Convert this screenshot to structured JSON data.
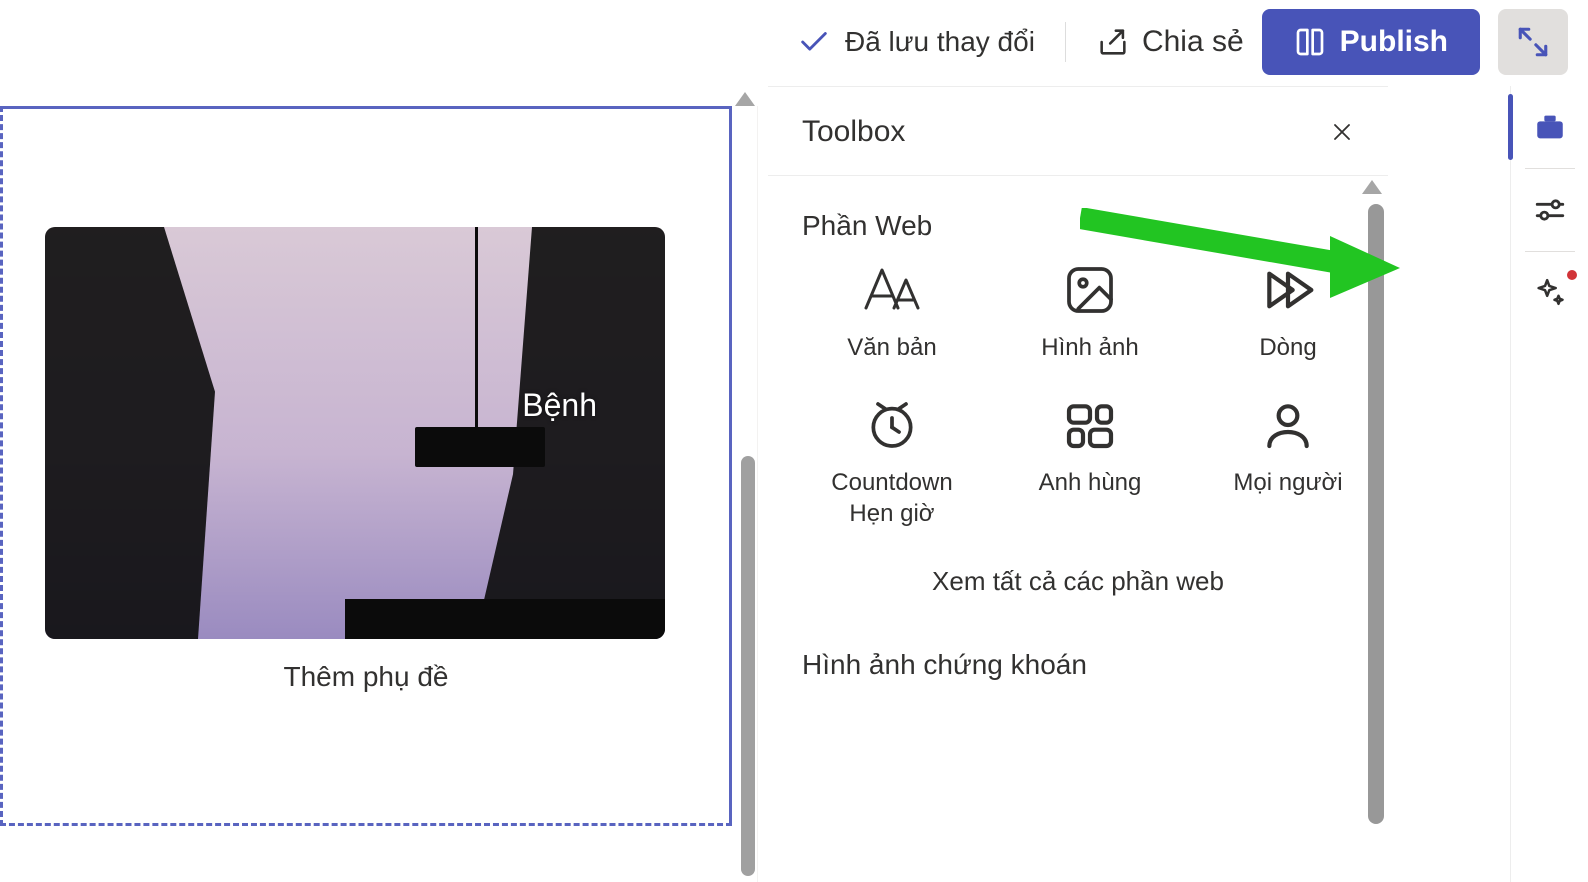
{
  "topbar": {
    "saved_label": "Đã lưu thay đổi",
    "share_label": "Chia sẻ",
    "publish_label": "Publish"
  },
  "canvas": {
    "image_overlay_text": "Bệnh",
    "caption_placeholder": "Thêm phụ đề"
  },
  "toolbox": {
    "title": "Toolbox",
    "section_webparts": "Phần Web",
    "see_all": "Xem tất cả các phần web",
    "section_stock": "Hình ảnh chứng khoán",
    "items": [
      {
        "label": "Văn bản"
      },
      {
        "label": "Hình ảnh"
      },
      {
        "label": "Dòng"
      },
      {
        "label": "Countdown\nHẹn giờ"
      },
      {
        "label": "Anh hùng"
      },
      {
        "label": "Mọi người"
      }
    ]
  },
  "rail": {
    "items": [
      {
        "name": "toolbox",
        "active": true
      },
      {
        "name": "settings",
        "active": false
      },
      {
        "name": "ai-sparkle",
        "active": false,
        "notification": true
      }
    ]
  }
}
